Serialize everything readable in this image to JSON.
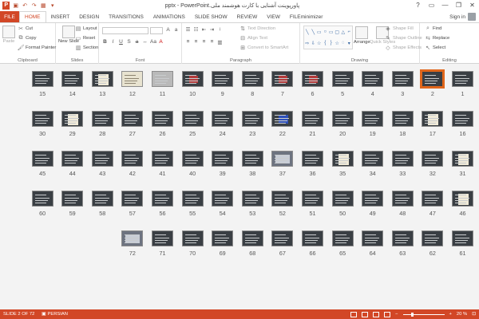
{
  "window": {
    "title": "پاورپوینت آشنایی با کارت هوشمند ملی.pptx - PowerPoint",
    "help": "?",
    "restore": "▭",
    "minimize": "—",
    "maximize": "❐",
    "close": "✕"
  },
  "tabs": [
    {
      "label": "FILE"
    },
    {
      "label": "HOME"
    },
    {
      "label": "INSERT"
    },
    {
      "label": "DESIGN"
    },
    {
      "label": "TRANSITIONS"
    },
    {
      "label": "ANIMATIONS"
    },
    {
      "label": "SLIDE SHOW"
    },
    {
      "label": "REVIEW"
    },
    {
      "label": "VIEW"
    },
    {
      "label": "FILEminimizer"
    }
  ],
  "signin": "Sign in",
  "ribbon": {
    "clipboard": {
      "label": "Clipboard",
      "paste": "Paste",
      "cut": "Cut",
      "copy": "Copy",
      "format_painter": "Format Painter"
    },
    "slides": {
      "label": "Slides",
      "new_slide": "New Slide",
      "layout": "Layout",
      "reset": "Reset",
      "section": "Section"
    },
    "font": {
      "label": "Font"
    },
    "paragraph": {
      "label": "Paragraph",
      "text_direction": "Text Direction",
      "align_text": "Align Text",
      "convert_smartart": "Convert to SmartArt"
    },
    "drawing": {
      "label": "Drawing",
      "arrange": "Arrange",
      "quick_styles": "Quick Styles",
      "shape_fill": "Shape Fill",
      "shape_outline": "Shape Outline",
      "shape_effects": "Shape Effects"
    },
    "editing": {
      "label": "Editing",
      "find": "Find",
      "replace": "Replace",
      "select": "Select"
    }
  },
  "slides": [
    {
      "n": "1",
      "kind": "dark"
    },
    {
      "n": "2",
      "kind": "selected"
    },
    {
      "n": "3",
      "kind": "dark"
    },
    {
      "n": "4",
      "kind": "dark"
    },
    {
      "n": "5",
      "kind": "dark"
    },
    {
      "n": "6",
      "kind": "img-red"
    },
    {
      "n": "7",
      "kind": "img-red"
    },
    {
      "n": "8",
      "kind": "dark"
    },
    {
      "n": "9",
      "kind": "dark"
    },
    {
      "n": "10",
      "kind": "img-red"
    },
    {
      "n": "11",
      "kind": "grey"
    },
    {
      "n": "12",
      "kind": "light"
    },
    {
      "n": "13",
      "kind": "img-doc"
    },
    {
      "n": "14",
      "kind": "dark"
    },
    {
      "n": "15",
      "kind": "dark"
    },
    {
      "n": "16",
      "kind": "dark"
    },
    {
      "n": "17",
      "kind": "img-doc"
    },
    {
      "n": "18",
      "kind": "dark"
    },
    {
      "n": "19",
      "kind": "dark"
    },
    {
      "n": "20",
      "kind": "dark"
    },
    {
      "n": "21",
      "kind": "dark"
    },
    {
      "n": "22",
      "kind": "img-blue"
    },
    {
      "n": "23",
      "kind": "dark"
    },
    {
      "n": "24",
      "kind": "dark"
    },
    {
      "n": "25",
      "kind": "dark"
    },
    {
      "n": "26",
      "kind": "dark"
    },
    {
      "n": "27",
      "kind": "dark"
    },
    {
      "n": "28",
      "kind": "dark"
    },
    {
      "n": "29",
      "kind": "img-doc"
    },
    {
      "n": "30",
      "kind": "dark"
    },
    {
      "n": "31",
      "kind": "img-doc"
    },
    {
      "n": "32",
      "kind": "dark"
    },
    {
      "n": "33",
      "kind": "dark"
    },
    {
      "n": "34",
      "kind": "dark"
    },
    {
      "n": "35",
      "kind": "img-doc"
    },
    {
      "n": "36",
      "kind": "dark"
    },
    {
      "n": "37",
      "kind": "photo"
    },
    {
      "n": "38",
      "kind": "dark"
    },
    {
      "n": "39",
      "kind": "dark"
    },
    {
      "n": "40",
      "kind": "dark"
    },
    {
      "n": "41",
      "kind": "dark"
    },
    {
      "n": "42",
      "kind": "dark"
    },
    {
      "n": "43",
      "kind": "dark"
    },
    {
      "n": "44",
      "kind": "dark"
    },
    {
      "n": "45",
      "kind": "dark"
    },
    {
      "n": "46",
      "kind": "img-doc"
    },
    {
      "n": "47",
      "kind": "dark"
    },
    {
      "n": "48",
      "kind": "dark"
    },
    {
      "n": "49",
      "kind": "dark"
    },
    {
      "n": "50",
      "kind": "dark"
    },
    {
      "n": "51",
      "kind": "dark"
    },
    {
      "n": "52",
      "kind": "dark"
    },
    {
      "n": "53",
      "kind": "dark"
    },
    {
      "n": "54",
      "kind": "dark"
    },
    {
      "n": "55",
      "kind": "dark"
    },
    {
      "n": "56",
      "kind": "dark"
    },
    {
      "n": "57",
      "kind": "dark"
    },
    {
      "n": "58",
      "kind": "dark"
    },
    {
      "n": "59",
      "kind": "dark"
    },
    {
      "n": "60",
      "kind": "dark"
    },
    {
      "n": "61",
      "kind": "dark"
    },
    {
      "n": "62",
      "kind": "dark"
    },
    {
      "n": "63",
      "kind": "dark"
    },
    {
      "n": "64",
      "kind": "dark"
    },
    {
      "n": "65",
      "kind": "dark"
    },
    {
      "n": "66",
      "kind": "dark"
    },
    {
      "n": "67",
      "kind": "dark"
    },
    {
      "n": "68",
      "kind": "dark"
    },
    {
      "n": "69",
      "kind": "dark"
    },
    {
      "n": "70",
      "kind": "dark"
    },
    {
      "n": "71",
      "kind": "dark"
    },
    {
      "n": "72",
      "kind": "photo"
    }
  ],
  "status": {
    "slide_counter": "SLIDE 2 OF 72",
    "language": "PERSIAN",
    "zoom": "20 %",
    "zoom_minus": "−",
    "zoom_plus": "+"
  },
  "colors": {
    "accent": "#d24726",
    "selection": "#e0661b",
    "slide_bg": "#3a3f44"
  }
}
